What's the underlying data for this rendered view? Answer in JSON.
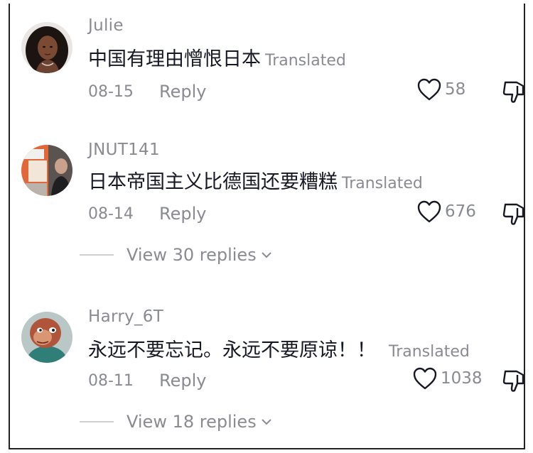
{
  "comments": [
    {
      "username": "Julie",
      "text": "中国有理由憎恨日本",
      "translated_label": "Translated",
      "date": "08-15",
      "reply_label": "Reply",
      "likes": "58"
    },
    {
      "username": "JNUT141",
      "text": "日本帝国主义比德国还要糟糕",
      "translated_label": "Translated",
      "date": "08-14",
      "reply_label": "Reply",
      "likes": "676",
      "view_replies": "View 30 replies"
    },
    {
      "username": "Harry_6T",
      "text": "永远不要忘记。永远不要原谅！！",
      "translated_label": "Translated",
      "date": "08-11",
      "reply_label": "Reply",
      "likes": "1038",
      "view_replies": "View 18 replies"
    }
  ],
  "icons": {
    "like": "heart-outline-icon",
    "dislike": "thumbs-down-outline-icon",
    "expand": "chevron-down-icon"
  },
  "colors": {
    "text_primary": "#161823",
    "text_secondary": "#8a8b91"
  }
}
